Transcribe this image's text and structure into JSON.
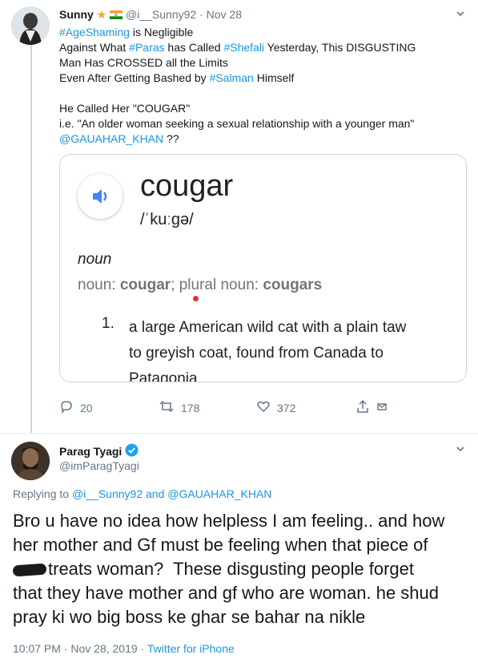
{
  "tweet1": {
    "display_name": "Sunny",
    "name_emoji": "★",
    "flag_label": "IN flag",
    "handle": "@i__Sunny92",
    "dot": "·",
    "time": "Nov 28",
    "lines": {
      "l1_tag": "#AgeShaming",
      "l1_rest": " is Negligible",
      "l2_a": "Against What ",
      "l2_tag1": "#Paras",
      "l2_b": " has Called ",
      "l2_tag2": "#Shefali",
      "l2_c": " Yesterday, This DISGUSTING",
      "l3": "Man Has CROSSED all the Limits",
      "l4_a": "Even After Getting Bashed by ",
      "l4_tag": "#Salman",
      "l4_b": " Himself",
      "l5": "He Called Her \"COUGAR\"",
      "l6": "i.e. \"An older woman seeking a sexual relationship with a younger man\"",
      "l7_mention": "@GAUAHAR_KHAN",
      "l7_rest": " ??"
    },
    "card": {
      "word": "cougar",
      "phonetic": "/ˈkuːɡə/",
      "pos": "noun",
      "forms_prefix": "noun: ",
      "forms_word": "cougar",
      "forms_mid": "; plural noun: ",
      "forms_plural": "cougars",
      "def_number": "1.",
      "def_line1": "a large American wild cat with a plain taw",
      "def_line2": "to greyish coat, found from Canada to",
      "def_line3": "Patagonia."
    },
    "actions": {
      "replies": "20",
      "retweets": "178",
      "likes": "372"
    }
  },
  "tweet2": {
    "display_name": "Parag Tyagi",
    "handle": "@imParagTyagi",
    "replying_prefix": "Replying to ",
    "reply_user1": "@i__Sunny92",
    "reply_and": " and ",
    "reply_user2": "@GAUAHAR_KHAN",
    "body": {
      "l1": "Bro u have no idea how helpless I am feeling.. and how",
      "l2": "her mother and Gf must be feeling when that piece of",
      "l3": "treats woman?  These disgusting people forget",
      "l4": "that they have mother and gf who are woman. he shud",
      "l5": "pray ki wo big boss ke ghar se bahar na nikle"
    },
    "timestamp": "10:07 PM · Nov 28, 2019 · ",
    "source": "Twitter for iPhone"
  },
  "colors": {
    "link": "#1b95e0",
    "muted": "#657786",
    "text": "#14171a",
    "verified": "#1da1f2",
    "speaker": "#4285f4"
  }
}
